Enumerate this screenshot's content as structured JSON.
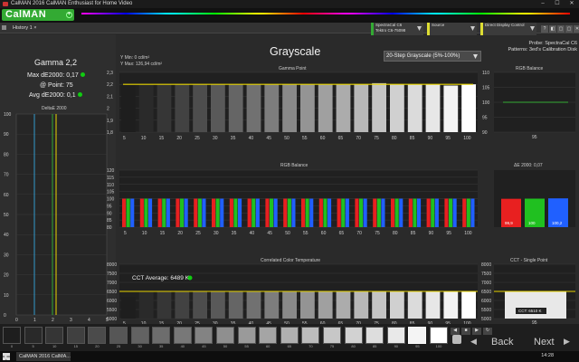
{
  "window": {
    "title": "CalMAN 2016 CalMAN Enthusiast for Home Video",
    "minimize": "–",
    "maximize": "☐",
    "close": "✕"
  },
  "app": {
    "logo": "CalMAN",
    "logo_plus": "+"
  },
  "tabs": [
    {
      "label": "History 1",
      "close": "×"
    }
  ],
  "devices": [
    {
      "name": "SpectraCal C6",
      "detail": "Tektro C6-75098"
    },
    {
      "name": "Source",
      "detail": ""
    },
    {
      "name": "Direct Display Control",
      "detail": ""
    }
  ],
  "toolbar_icons": [
    "?",
    "◧",
    "▢",
    "▢",
    "✕"
  ],
  "left_panel": {
    "gamma_label": "Gamma 2,2",
    "max_de": "Max dE2000: 0,17",
    "at_point": "@ Point: 75",
    "avg_de": "Avg dE2000: 0,1",
    "delta_title": "DeltaE 2000",
    "y_ticks": [
      "100",
      "90",
      "80",
      "70",
      "60",
      "50",
      "40",
      "30",
      "20",
      "10",
      "0"
    ],
    "x_ticks": [
      "0",
      "1",
      "2",
      "3",
      "4",
      "5"
    ]
  },
  "main": {
    "title": "Grayscale",
    "ymin": "Y Min: 0 cd/m²",
    "ymax": "Y Max: 126,94 cd/m²",
    "select_value": "20-Step Grayscale (5%-100%)",
    "probe": "Probe: SpectraCal C6",
    "patterns": "Patterns: 3ed's Calibration Disk"
  },
  "gamma_chart": {
    "title": "Gamma Point",
    "yticks": [
      "2,3",
      "2,2",
      "2,1",
      "2",
      "1,9",
      "1,8"
    ],
    "categories": [
      "5",
      "10",
      "15",
      "20",
      "25",
      "30",
      "35",
      "40",
      "45",
      "50",
      "55",
      "60",
      "65",
      "70",
      "75",
      "80",
      "85",
      "90",
      "95",
      "100"
    ],
    "target": 2.2,
    "values": [
      2.19,
      2.2,
      2.2,
      2.2,
      2.2,
      2.2,
      2.2,
      2.2,
      2.2,
      2.2,
      2.2,
      2.2,
      2.2,
      2.2,
      2.21,
      2.2,
      2.2,
      2.2,
      2.19,
      2.2
    ]
  },
  "rgb_chart": {
    "title": "RGB Balance",
    "yticks": [
      "120",
      "115",
      "110",
      "105",
      "100",
      "95",
      "90",
      "85",
      "80"
    ],
    "categories": [
      "5",
      "10",
      "15",
      "20",
      "25",
      "30",
      "35",
      "40",
      "45",
      "50",
      "55",
      "60",
      "65",
      "70",
      "75",
      "80",
      "85",
      "90",
      "95",
      "100"
    ]
  },
  "rgb_balance_small": {
    "title": "RGB Balance",
    "yticks": [
      "110",
      "105",
      "100",
      "95",
      "90"
    ],
    "category": "95"
  },
  "de_small": {
    "title": "ΔE 2000: 0,07",
    "r": "99,9",
    "g": "100",
    "b": "100,2",
    "ylim": [
      80,
      120
    ]
  },
  "cct_chart": {
    "title": "Correlated Color Temperature",
    "average": "CCT Average: 6489 K",
    "yticks": [
      "8000",
      "7500",
      "7000",
      "6500",
      "6000",
      "5500",
      "5000"
    ],
    "categories": [
      "5",
      "10",
      "15",
      "20",
      "25",
      "30",
      "35",
      "40",
      "45",
      "50",
      "55",
      "60",
      "65",
      "70",
      "75",
      "80",
      "85",
      "90",
      "95",
      "100"
    ],
    "target": 6500,
    "values": [
      6180,
      6470,
      6490,
      6500,
      6490,
      6500,
      6495,
      6500,
      6490,
      6495,
      6500,
      6495,
      6490,
      6495,
      6500,
      6495,
      6500,
      6490,
      6510,
      6500
    ]
  },
  "cct_small": {
    "title": "CCT - Single Point",
    "yticks": [
      "8000",
      "7500",
      "7000",
      "6500",
      "6000",
      "5500",
      "5000"
    ],
    "value_label": "CCT: 6510 K",
    "category": "95"
  },
  "swatches": {
    "labels": [
      "0",
      "5",
      "10",
      "15",
      "20",
      "25",
      "30",
      "35",
      "40",
      "45",
      "50",
      "55",
      "60",
      "65",
      "70",
      "75",
      "80",
      "85",
      "90",
      "95",
      "100"
    ],
    "active": "95"
  },
  "nav": {
    "back": "Back",
    "next": "Next"
  },
  "colors": {
    "accent": "#33aa33",
    "target": "#e8d400",
    "red": "#e82020",
    "green": "#20c020",
    "blue": "#2060ff"
  },
  "taskbar": {
    "item": "CalMAN 2016 CalMA...",
    "time": "14:28"
  }
}
